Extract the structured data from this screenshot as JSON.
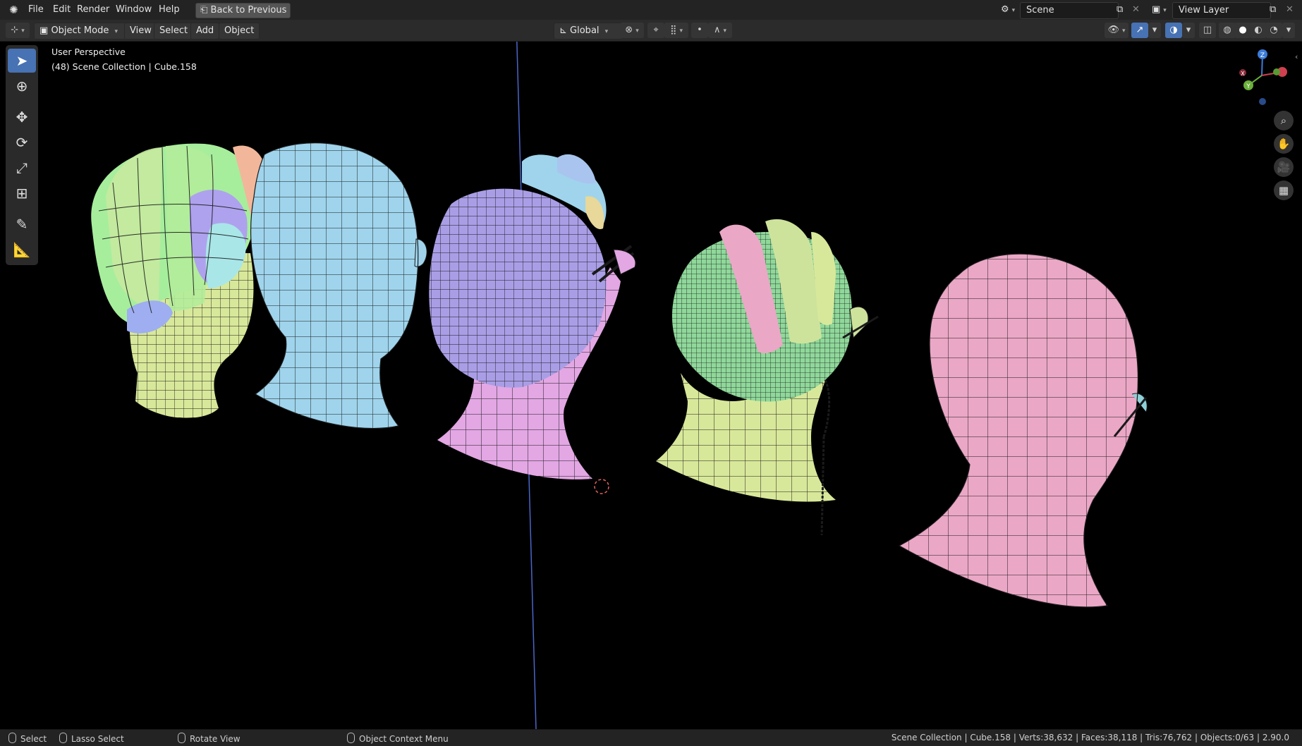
{
  "menus": [
    "File",
    "Edit",
    "Render",
    "Window",
    "Help"
  ],
  "back_button": "Back to Previous",
  "scene_field": "Scene",
  "view_layer_field": "View Layer",
  "header": {
    "mode": "Object Mode",
    "menus": [
      "View",
      "Select",
      "Add",
      "Object"
    ],
    "transform_orientation": "Global"
  },
  "viewport": {
    "perspective": "User Perspective",
    "collection": "(48) Scene Collection | Cube.158"
  },
  "gizmo": {
    "z": "Z",
    "y": "Y",
    "x": "X"
  },
  "status": {
    "select": "Select",
    "lasso": "Lasso Select",
    "rotate": "Rotate View",
    "context": "Object Context Menu",
    "stats": "Scene Collection | Cube.158 | Verts:38,632 | Faces:38,118 | Tris:76,762 | Objects:0/63 | 2.90.0"
  },
  "colors": {
    "accent": "#4772b3",
    "head_yellow": "#d8e89a",
    "head_blue": "#9fd4ec",
    "head_purple": "#a99ee6",
    "head_magenta": "#e3a7e4",
    "head_green": "#8fd89a",
    "head_pink": "#eba7c6"
  }
}
